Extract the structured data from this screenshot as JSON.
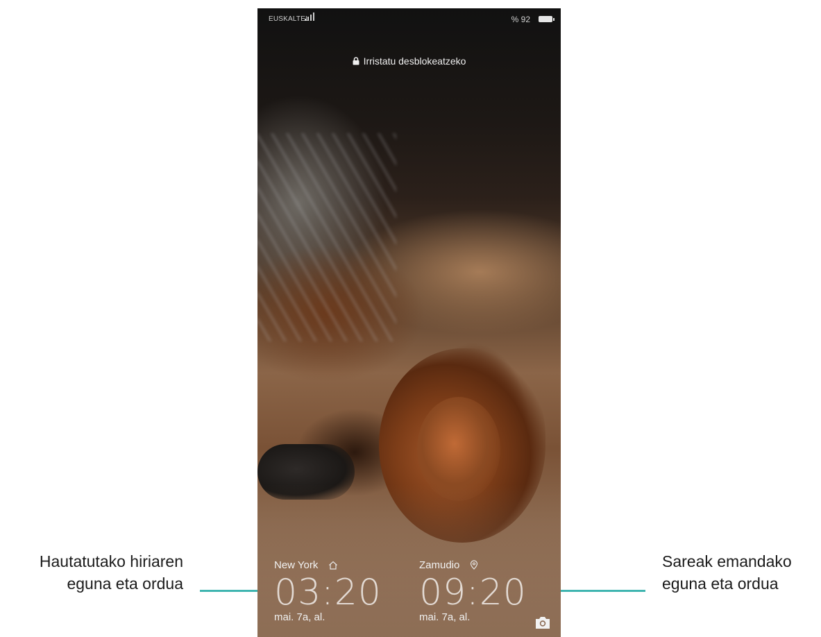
{
  "status_bar": {
    "carrier": "EUSKALTEL",
    "battery_percent": "% 92",
    "signal_icon": "signal-bars-icon",
    "battery_icon": "battery-icon"
  },
  "lock_screen": {
    "unlock_hint": "Irristatu desblokeatzeko",
    "clocks": [
      {
        "city": "New York",
        "city_icon": "home-icon",
        "time": "03:20",
        "date": "mai. 7a, al."
      },
      {
        "city": "Zamudio",
        "city_icon": "location-pin-icon",
        "time": "09:20",
        "date": "mai. 7a, al."
      }
    ],
    "camera_icon": "camera-icon"
  },
  "annotations": {
    "left": {
      "line1": "Hautatutako hiriaren",
      "line2": "eguna eta ordua"
    },
    "right": {
      "line1": "Sareak emandako",
      "line2": "eguna eta ordua"
    },
    "leader_color": "#3fb5b0"
  }
}
